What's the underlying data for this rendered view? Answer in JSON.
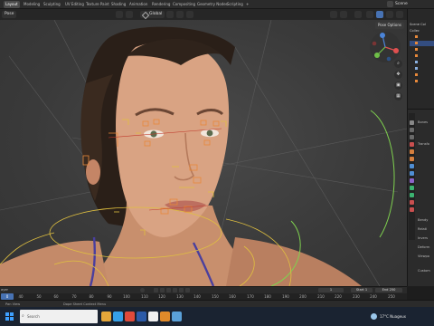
{
  "topbar": {
    "tabs": [
      "Layout",
      "Modeling",
      "Sculpting",
      "UV Editing",
      "Texture Paint",
      "Shading",
      "Animation",
      "Rendering",
      "Compositing",
      "Geometry Nodes",
      "Scripting"
    ],
    "add_tab": "+",
    "scene": "Scene"
  },
  "viewport_header": {
    "mode": "Pose",
    "orientation": "Global",
    "pose_options": "Pose Options"
  },
  "outliner": {
    "rows": [
      "Scene Col",
      "Collec",
      "",
      "",
      "",
      "",
      "",
      "",
      "",
      ""
    ]
  },
  "properties": {
    "header": "Bones",
    "rows": [
      "Transfo",
      "",
      "",
      "",
      "Bendy",
      "Relati",
      "Invers",
      "Deform",
      "Viewpo",
      "Custom"
    ]
  },
  "timeline": {
    "menu": "ayer",
    "current_frame": "1",
    "start_label": "Start",
    "start": "1",
    "end_label": "End",
    "end": "250",
    "ticks": [
      "0",
      "40",
      "50",
      "60",
      "70",
      "80",
      "90",
      "100",
      "110",
      "120",
      "130",
      "140",
      "150",
      "160",
      "170",
      "180",
      "190",
      "200",
      "210",
      "220",
      "230",
      "240",
      "250"
    ]
  },
  "statusbar": {
    "left": "Pan View",
    "center": "Dope Sheet Context Menu"
  },
  "taskbar": {
    "search_placeholder": "Search",
    "weather": "17°C  Nuageux"
  },
  "colors": {
    "viewport_bg": "#3d3d3d",
    "rig_yellow": "#e0c040",
    "rig_orange": "#e8893a",
    "rig_green": "#7fd14f",
    "selection_blue": "#4772b3"
  }
}
